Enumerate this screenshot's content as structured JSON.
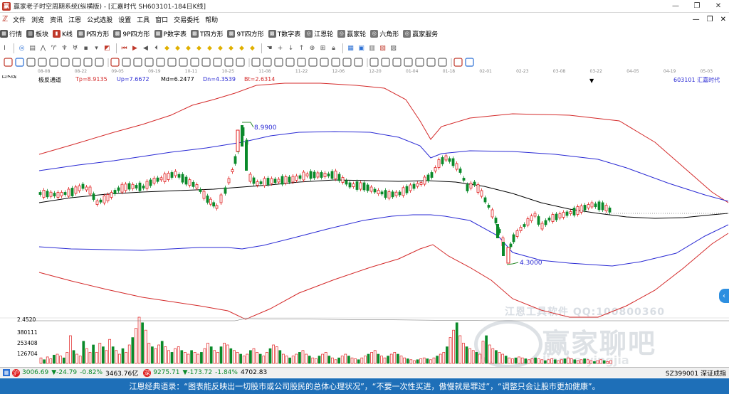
{
  "window": {
    "title": "赢家老子时空周期系统(纵横版) - [汇嘉时代  SH603101-184日K线]",
    "controls": [
      "—",
      "❐",
      "✕"
    ]
  },
  "menu": {
    "items": [
      "文件",
      "浏览",
      "资讯",
      "江恩",
      "公式选股",
      "设置",
      "工具",
      "窗口",
      "交易委托",
      "帮助"
    ],
    "right_controls": [
      "—",
      "❐",
      "✕"
    ]
  },
  "toolbar1": {
    "items": [
      {
        "label": "行情",
        "icon": "grid-icon",
        "color": "#333333"
      },
      {
        "label": "板块",
        "icon": "blocks-icon",
        "color": "#333333"
      },
      {
        "label": "K线",
        "icon": "kline-icon",
        "color": "#c0392b"
      },
      {
        "label": "P四方形",
        "icon": "p-square-icon",
        "color": "#444444"
      },
      {
        "label": "9P四方形",
        "icon": "9p-square-icon",
        "color": "#444444"
      },
      {
        "label": "P数字表",
        "icon": "p-table-icon",
        "color": "#444444"
      },
      {
        "label": "T四方形",
        "icon": "t-square-icon",
        "color": "#444444"
      },
      {
        "label": "9T四方形",
        "icon": "9t-square-icon",
        "color": "#444444"
      },
      {
        "label": "T数字表",
        "icon": "t-table-icon",
        "color": "#444444"
      },
      {
        "label": "江恩轮",
        "icon": "gann-wheel-icon",
        "color": "#444444"
      },
      {
        "label": "赢家轮",
        "icon": "winner-wheel-icon",
        "color": "#444444"
      },
      {
        "label": "六角形",
        "icon": "hexagon-icon",
        "color": "#444444"
      },
      {
        "label": "赢家服务",
        "icon": "service-icon",
        "color": "#444444"
      }
    ]
  },
  "chart_header": {
    "period": "日K线",
    "indicator": "极反通道",
    "tp": "Tp=8.9135",
    "up": "Up=7.6672",
    "md": "Md=6.2477",
    "dn": "Dn=4.3539",
    "bt": "Bt=2.6314",
    "stock": "603101  汇嘉时代",
    "dates": [
      "08-08",
      "08-22",
      "09-05",
      "09-19",
      "10-11",
      "10-25",
      "11-08",
      "11-22",
      "12-06",
      "12-20",
      "01-04",
      "01-18",
      "02-01",
      "02-23",
      "03-08",
      "03-22",
      "04-05",
      "04-19",
      "05-03"
    ]
  },
  "annotations": {
    "high": "8.9900",
    "low": "4.3000"
  },
  "volume_axis": {
    "labels": [
      "2.4520",
      "380111",
      "253408",
      "126704"
    ]
  },
  "watermark": {
    "line1": "江恩工具软件  QQ:100800360",
    "line2": "赢家聊吧",
    "line3": "liaoba.yingjia"
  },
  "statusbar": {
    "sh_label": "沪",
    "sh_index": "3006.69",
    "sh_change": "▼-24.79",
    "sh_pct": "-0.82%",
    "sh_amount": "3463.76亿",
    "sz_label": "深",
    "sz_index": "9275.71",
    "sz_change": "▼-173.72",
    "sz_pct": "-1.84%",
    "sz_amount": "4702.83",
    "right": "SZ399001 深证成指"
  },
  "quote": {
    "text": "江恩经典语录：“图表能反映出一切股市或公司股民的总体心理状况”，“不要一次性买进，傲慢就是罪过”，“调整只会让股市更加健康”。"
  },
  "colors": {
    "band_outer": "#d42a2a",
    "band_inner": "#2a2ad4",
    "middle": "#000000",
    "up_candle": "#e01e1e",
    "down_candle": "#0a8a2a",
    "quote_bg": "#1e6fb8"
  }
}
